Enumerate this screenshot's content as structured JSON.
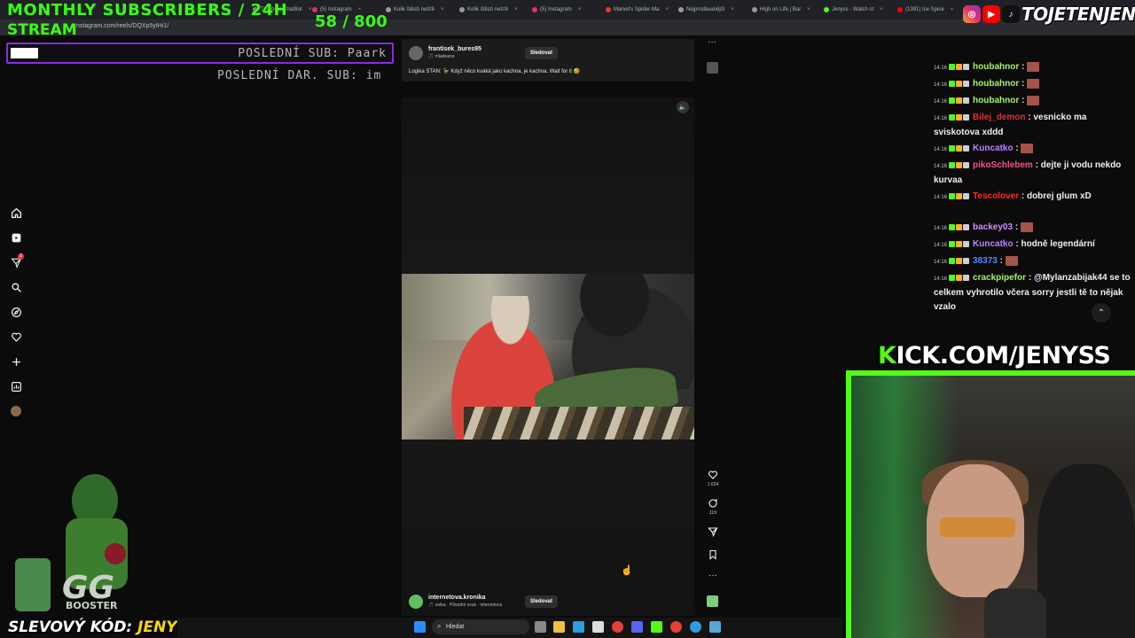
{
  "overlay": {
    "title_line1": "MONTHLY SUBSCRIBERS / 24H",
    "title_line2": "STREAM",
    "sub_count": "58",
    "sub_goal": "/ 800",
    "progress_fraction": 0.0725,
    "last_sub": "POSLEDNÍ SUB: Paark",
    "last_gift": "POSLEDNÍ DAR. SUB: im",
    "promo_prefix": "SLEVOVÝ KÓD:",
    "promo_code": "JENYS",
    "brand": "TOJETENJENYS",
    "kick": "KICK.COM/JENYSS",
    "kick_initial": "K",
    "kick_rest": "ICK.COM/JENYSS"
  },
  "browser": {
    "url": "nstagram.com/reels/DQXp5yIHi1/",
    "tabs": [
      {
        "label": "The best ChatBot",
        "color": "#9a9a9a"
      },
      {
        "label": "(5) Instagram",
        "color": "#e1306c"
      },
      {
        "label": "Kolik štěstí nešťě",
        "color": "#9a9a9a"
      },
      {
        "label": "Kolik štěstí nešťě",
        "color": "#9a9a9a"
      },
      {
        "label": "(5) Instagram",
        "color": "#e1306c"
      },
      {
        "label": "Marvel's Spider-Ma",
        "color": "#e23c2c"
      },
      {
        "label": "Nejprodávanější",
        "color": "#9a9a9a"
      },
      {
        "label": "High on Life | Bar",
        "color": "#9a9a9a"
      },
      {
        "label": "Jenyss - Watch st",
        "color": "#53fc18"
      },
      {
        "label": "(1391) Ice Spice",
        "color": "#ff0000"
      }
    ]
  },
  "instagram": {
    "sidebar_icons": [
      "home-icon",
      "reels-icon",
      "messages-icon",
      "search-icon",
      "explore-icon",
      "heart-icon",
      "create-icon",
      "dashboard-icon",
      "profile-avatar"
    ],
    "messages_badge": "2",
    "top_post": {
      "username": "frantisek_bures95",
      "sub": "🎵 mladeano",
      "follow": "Sledovat",
      "caption": "Logika STAN: 🦆 Když něco kváká jako kachna, je kachna. Wait for it 🤣"
    },
    "actions": {
      "likes": "1 624",
      "comments": "119"
    },
    "bottom_post": {
      "username": "internetova.kronika",
      "sub": "🎵 onika · Původní zvuk · internetova",
      "follow": "Sledovat"
    }
  },
  "chat": {
    "messages": [
      {
        "time": "14:16",
        "user": "houbahnor",
        "color": "#a8f06a",
        "text": "",
        "emote": true
      },
      {
        "time": "14:16",
        "user": "houbahnor",
        "color": "#a8f06a",
        "text": "",
        "emote": true
      },
      {
        "time": "14:16",
        "user": "houbahnor",
        "color": "#a8f06a",
        "text": "",
        "emote": true
      },
      {
        "time": "14:16",
        "user": "Bilej_demon",
        "color": "#e0303a",
        "text": "vesnicko ma sviskotova xddd",
        "emote": false
      },
      {
        "time": "14:16",
        "user": "Kuncatko",
        "color": "#c080ff",
        "text": "",
        "emote": true
      },
      {
        "time": "14:16",
        "user": "pikoSchlebem",
        "color": "#ff4f8a",
        "text": "dejte ji vodu nekdo kurvaa",
        "emote": false
      },
      {
        "time": "14:16",
        "user": "Tescolover",
        "color": "#ff2a2a",
        "text": "dobrej glum xD",
        "emote": false
      },
      {
        "time": "14:16",
        "user": "backey03",
        "color": "#d48bff",
        "text": "",
        "emote": true
      },
      {
        "time": "14:16",
        "user": "Kuncatko",
        "color": "#c080ff",
        "text": "hodně legendární",
        "emote": false
      },
      {
        "time": "14:16",
        "user": "38373",
        "color": "#4f8cff",
        "text": "",
        "emote": true
      },
      {
        "time": "14:16",
        "user": "crackpipefor",
        "color": "#a8f06a",
        "text": "@Mylanzabijak44 se to celkem vyhrotilo včera sorry jestli tě to nějak vzalo",
        "emote": false
      }
    ]
  },
  "taskbar": {
    "search_placeholder": "Hledat"
  }
}
